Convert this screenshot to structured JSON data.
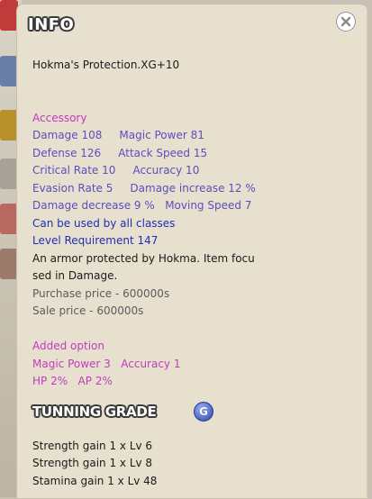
{
  "window": {
    "title": "INFO",
    "close_icon": "close-icon"
  },
  "item": {
    "name": "Hokma's Protection.XG+10",
    "category": "Accessory",
    "stats": [
      "Damage 108     Magic Power 81",
      "Defense 126     Attack Speed 15",
      "Critical Rate 10     Accuracy 10",
      "Evasion Rate 5     Damage increase 12 %",
      "Damage decrease 9 %   Moving Speed 7"
    ],
    "class_restriction": "Can be used by all classes",
    "level_requirement": "Level Requirement 147",
    "description": [
      "An armor protected by Hokma. Item focu",
      "sed in Damage."
    ],
    "purchase_price": "Purchase price - 600000s",
    "sale_price": "Sale price - 600000s"
  },
  "added_option": {
    "header": "Added option",
    "lines": [
      "Magic Power 3   Accuracy 1",
      "HP 2%   AP 2%"
    ]
  },
  "tunning": {
    "title": "TUNNING GRADE",
    "grade": "G",
    "gains": [
      "Strength gain 1 x Lv 6",
      "Strength gain 1 x Lv 8",
      "Stamina gain 1 x Lv 48"
    ]
  },
  "colors": {
    "panel_bg": "#e7e0ce",
    "category": "#c13bbd",
    "stats": "#5a4ec0",
    "requirement": "#1e2fb0",
    "description": "#1a1a1a",
    "price": "#5c5c5c"
  }
}
